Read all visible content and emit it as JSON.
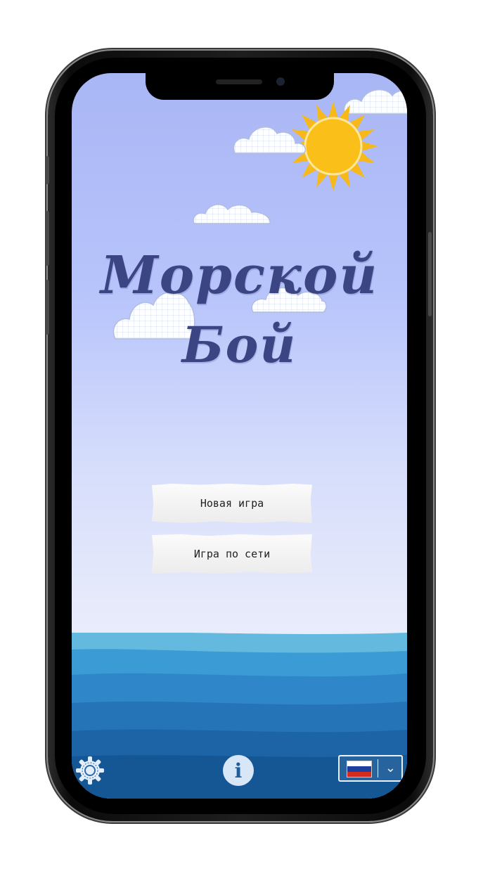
{
  "app": {
    "title_line1": "Морской",
    "title_line2": "Бой"
  },
  "menu": {
    "new_game_label": "Новая игра",
    "online_game_label": "Игра по сети"
  },
  "footer": {
    "settings_icon": "gear-icon",
    "info_icon": "info-icon",
    "info_glyph": "i",
    "language_flag": "russia-flag-icon",
    "language_chevron": "chevron-down-icon"
  },
  "colors": {
    "title": "#3c4584",
    "sun": "#fbbf1a",
    "sea_light": "#62b8de",
    "sea_dark": "#155694"
  }
}
